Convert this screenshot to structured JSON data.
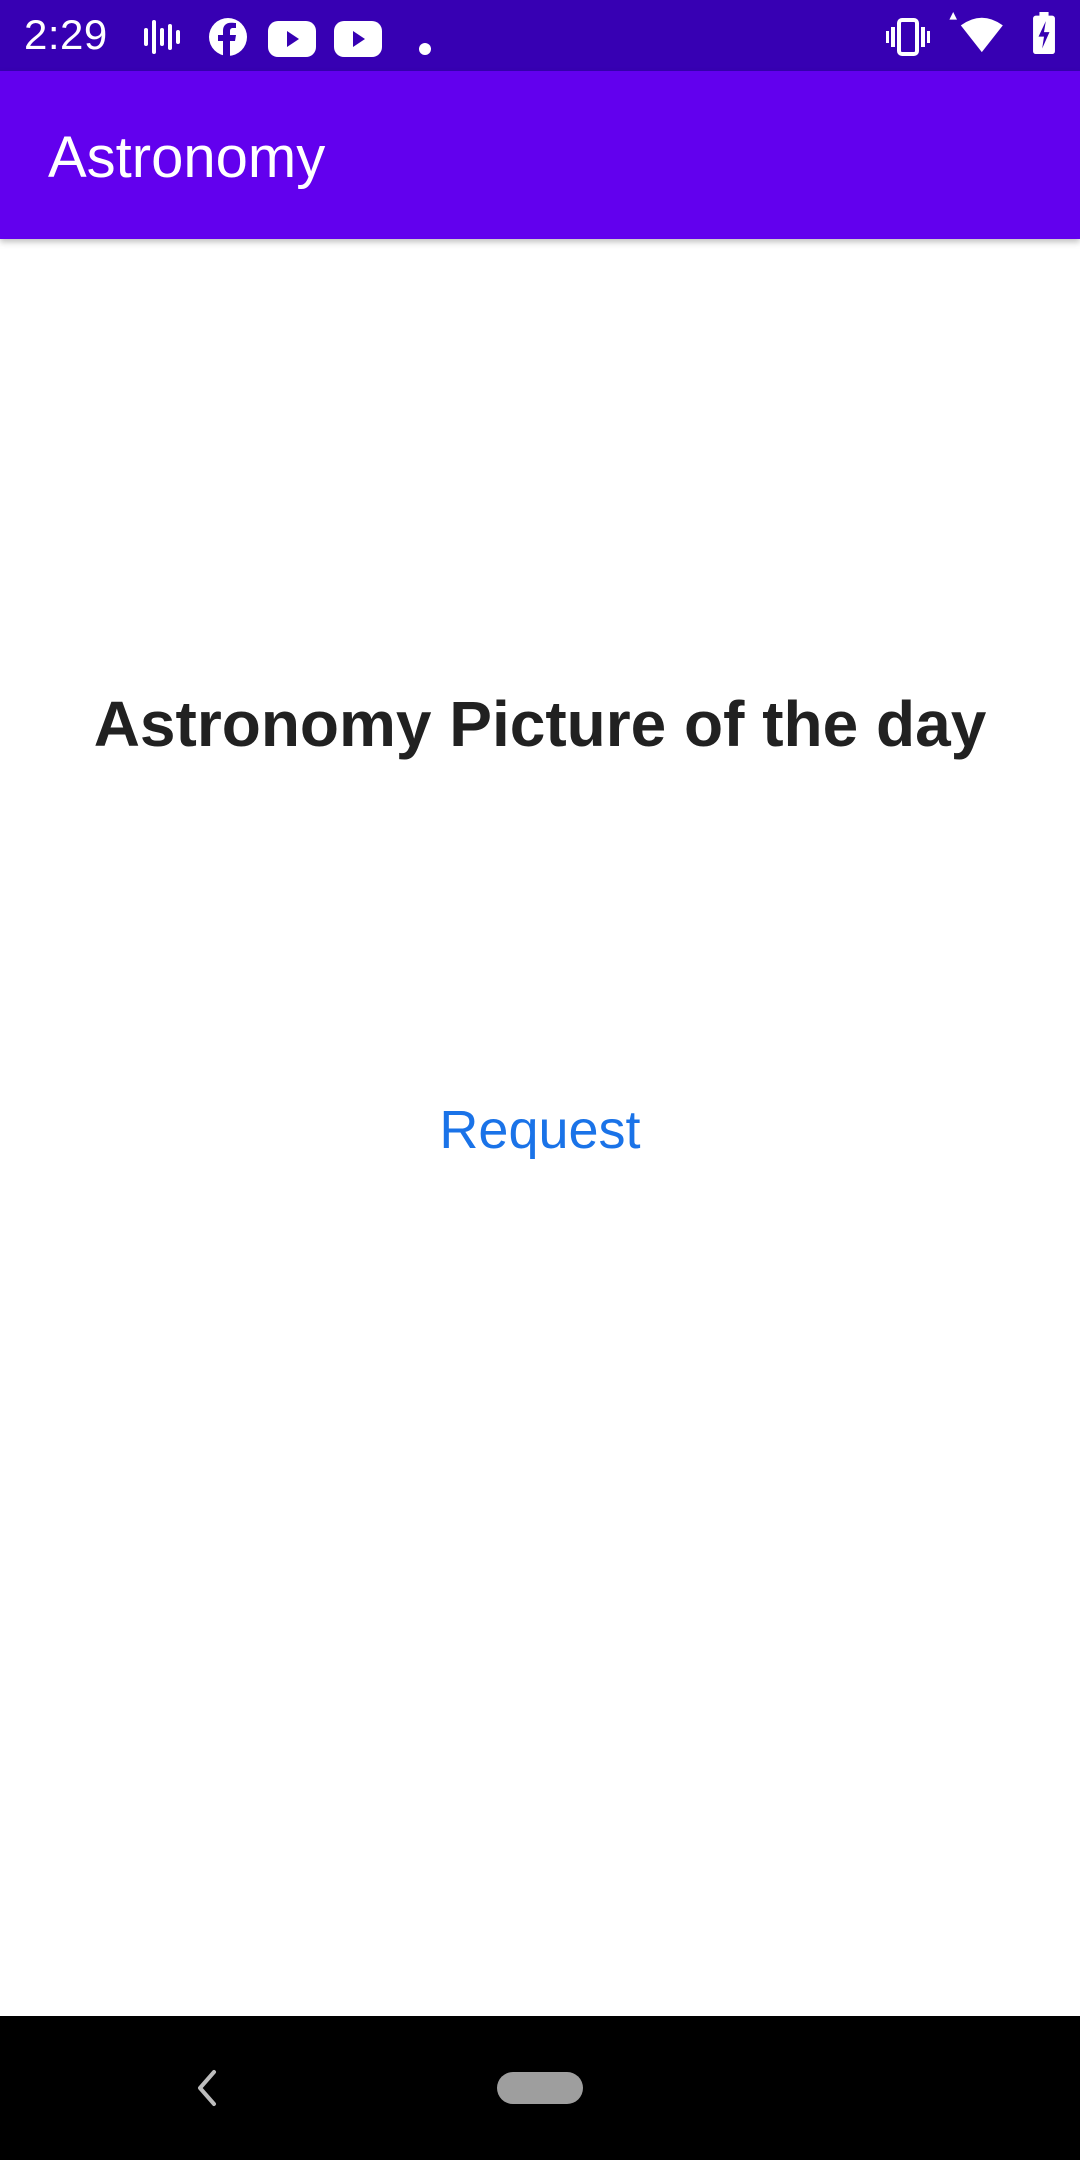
{
  "status_bar": {
    "time": "2:29",
    "background": "#3700b3",
    "left_icons": [
      "signal-bars-icon",
      "facebook-icon",
      "youtube-icon",
      "youtube-icon",
      "notification-dot-icon"
    ],
    "right_icons": [
      "vibrate-icon",
      "wifi-icon",
      "battery-charging-icon"
    ]
  },
  "app_bar": {
    "title": "Astronomy",
    "background": "#6200ee"
  },
  "main": {
    "headline": "Astronomy Picture of the day",
    "request_label": "Request",
    "accent": "#1a73e8"
  },
  "nav_bar": {
    "icons": [
      "back-icon",
      "home-pill-icon"
    ]
  }
}
